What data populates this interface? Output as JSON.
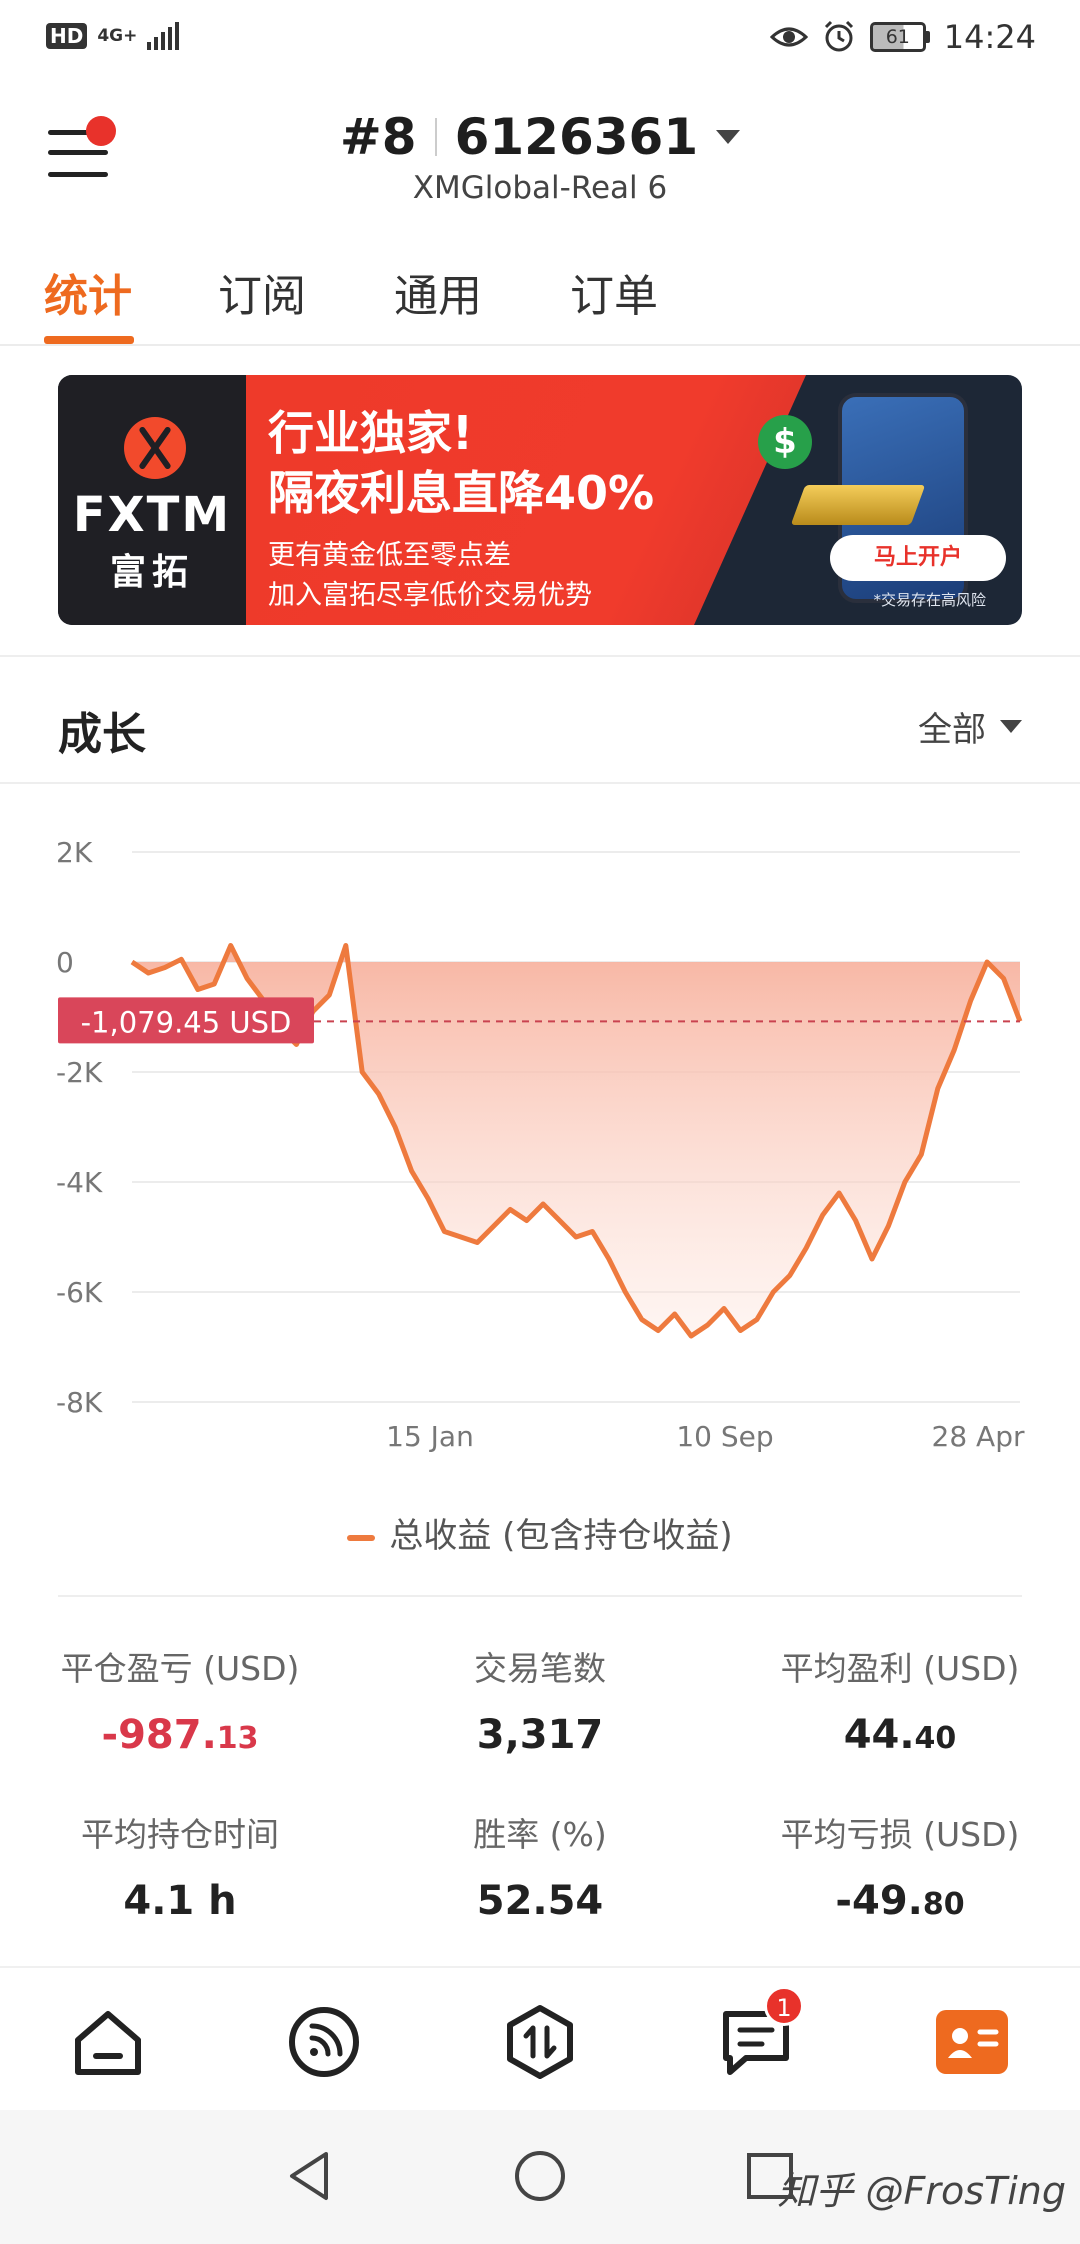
{
  "status_bar": {
    "hd": "HD",
    "network": "4G+",
    "battery": "61",
    "time": "14:24"
  },
  "header": {
    "account_index": "#8",
    "account_number": "6126361",
    "server": "XMGlobal-Real 6"
  },
  "tabs": [
    {
      "label": "统计",
      "active": true
    },
    {
      "label": "订阅",
      "active": false
    },
    {
      "label": "通用",
      "active": false
    },
    {
      "label": "订单",
      "active": false
    }
  ],
  "banner": {
    "brand": "FXTM",
    "brand_cn": "富拓",
    "headline_1": "行业独家!",
    "headline_2": "隔夜利息直降40%",
    "sub_1": "更有黄金低至零点差",
    "sub_2": "加入富拓尽享低价交易优势",
    "cta": "马上开户",
    "risk": "*交易存在高风险"
  },
  "growth": {
    "title": "成长",
    "filter": "全部",
    "current_label": "-1,079.45 USD",
    "legend": "总收益 (包含持仓收益)"
  },
  "chart_data": {
    "type": "area",
    "y_ticks": [
      "2K",
      "0",
      "-2K",
      "-4K",
      "-6K",
      "-8K"
    ],
    "x_ticks": [
      "15 Jan",
      "10 Sep",
      "28 Apr"
    ],
    "ylim": [
      -8000,
      2000
    ],
    "current_value": -1079.45,
    "series": [
      {
        "name": "总收益 (包含持仓收益)",
        "color": "#ee7a3e",
        "values": [
          0,
          -200,
          -100,
          50,
          -500,
          -400,
          300,
          -300,
          -700,
          -1200,
          -1500,
          -900,
          -600,
          300,
          -2000,
          -2400,
          -3000,
          -3800,
          -4300,
          -4900,
          -5000,
          -5100,
          -4800,
          -4500,
          -4700,
          -4400,
          -4700,
          -5000,
          -4900,
          -5400,
          -6000,
          -6500,
          -6700,
          -6400,
          -6800,
          -6600,
          -6300,
          -6700,
          -6500,
          -6000,
          -5700,
          -5200,
          -4600,
          -4200,
          -4700,
          -5400,
          -4800,
          -4000,
          -3500,
          -2300,
          -1600,
          -700,
          0,
          -300,
          -1079
        ]
      }
    ]
  },
  "stats": [
    {
      "label": "平仓盈亏 (USD)",
      "int": "-987.",
      "dec": "13",
      "negative": true
    },
    {
      "label": "交易笔数",
      "int": "3,317",
      "dec": "",
      "negative": false
    },
    {
      "label": "平均盈利 (USD)",
      "int": "44.",
      "dec": "40",
      "negative": false
    },
    {
      "label": "平均持仓时间",
      "int": "4.1 h",
      "dec": "",
      "negative": false
    },
    {
      "label": "胜率 (%)",
      "int": "52.54",
      "dec": "",
      "negative": false
    },
    {
      "label": "平均亏损 (USD)",
      "int": "-49.",
      "dec": "80",
      "negative": false
    }
  ],
  "bottom_nav": {
    "items": [
      "home-icon",
      "feed-icon",
      "trade-icon",
      "messages-icon",
      "profile-icon"
    ],
    "messages_badge": "1",
    "active_color": "#ee6a1f"
  },
  "watermark": "知乎 @FrosTing"
}
